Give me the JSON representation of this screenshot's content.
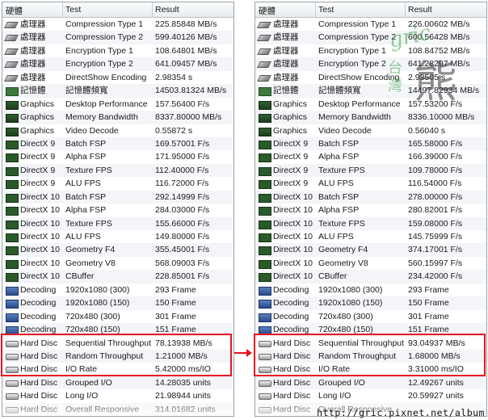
{
  "columns": {
    "device": "硬體",
    "test": "Test",
    "result": "Result"
  },
  "left_rows": [
    {
      "icon": "cpu",
      "device": "處理器",
      "test": "Compression Type 1",
      "result": "225.85848 MB/s"
    },
    {
      "icon": "cpu",
      "device": "處理器",
      "test": "Compression Type 2",
      "result": "599.40126 MB/s"
    },
    {
      "icon": "cpu",
      "device": "處理器",
      "test": "Encryption Type 1",
      "result": "108.64801 MB/s"
    },
    {
      "icon": "cpu",
      "device": "處理器",
      "test": "Encryption Type 2",
      "result": "641.09457 MB/s"
    },
    {
      "icon": "cpu",
      "device": "處理器",
      "test": "DirectShow Encoding",
      "result": "2.98354 s"
    },
    {
      "icon": "mem",
      "device": "記憶體",
      "test": "記憶體頻寬",
      "result": "14503.81324 MB/s"
    },
    {
      "icon": "gpu",
      "device": "Graphics",
      "test": "Desktop Performance",
      "result": "157.56400 F/s"
    },
    {
      "icon": "gpu",
      "device": "Graphics",
      "test": "Memory Bandwidth",
      "result": "8337.80000 MB/s"
    },
    {
      "icon": "gpu",
      "device": "Graphics",
      "test": "Video Decode",
      "result": "0.55872 s"
    },
    {
      "icon": "dx",
      "device": "DirectX 9",
      "test": "Batch FSP",
      "result": "169.57001 F/s"
    },
    {
      "icon": "dx",
      "device": "DirectX 9",
      "test": "Alpha FSP",
      "result": "171.95000 F/s"
    },
    {
      "icon": "dx",
      "device": "DirectX 9",
      "test": "Texture FPS",
      "result": "112.40000 F/s"
    },
    {
      "icon": "dx",
      "device": "DirectX 9",
      "test": "ALU FPS",
      "result": "116.72000 F/s"
    },
    {
      "icon": "dx",
      "device": "DirectX 10",
      "test": "Batch FSP",
      "result": "292.14999 F/s"
    },
    {
      "icon": "dx",
      "device": "DirectX 10",
      "test": "Alpha FSP",
      "result": "284.03000 F/s"
    },
    {
      "icon": "dx",
      "device": "DirectX 10",
      "test": "Texture FPS",
      "result": "155.66000 F/s"
    },
    {
      "icon": "dx",
      "device": "DirectX 10",
      "test": "ALU FPS",
      "result": "149.80000 F/s"
    },
    {
      "icon": "dx",
      "device": "DirectX 10",
      "test": "Geometry F4",
      "result": "355.45001 F/s"
    },
    {
      "icon": "dx",
      "device": "DirectX 10",
      "test": "Geometry V8",
      "result": "568.09003 F/s"
    },
    {
      "icon": "dx",
      "device": "DirectX 10",
      "test": "CBuffer",
      "result": "228.85001 F/s"
    },
    {
      "icon": "dec",
      "device": "Decoding",
      "test": "1920x1080 (300)",
      "result": "293 Frame"
    },
    {
      "icon": "dec",
      "device": "Decoding",
      "test": "1920x1080 (150)",
      "result": "150 Frame"
    },
    {
      "icon": "dec",
      "device": "Decoding",
      "test": "720x480 (300)",
      "result": "301 Frame"
    },
    {
      "icon": "dec",
      "device": "Decoding",
      "test": "720x480 (150)",
      "result": "151 Frame"
    },
    {
      "icon": "hd",
      "device": "Hard Disc",
      "test": "Sequential Throughput",
      "result": "78.13938 MB/s"
    },
    {
      "icon": "hd",
      "device": "Hard Disc",
      "test": "Random Throughput",
      "result": "1.21000 MB/s"
    },
    {
      "icon": "hd",
      "device": "Hard Disc",
      "test": "I/O Rate",
      "result": "5.42000 ms/IO"
    },
    {
      "icon": "hd",
      "device": "Hard Disc",
      "test": "Grouped I/O",
      "result": "14.28035 units"
    },
    {
      "icon": "hd",
      "device": "Hard Disc",
      "test": "Long I/O",
      "result": "21.98944 units"
    },
    {
      "icon": "hd",
      "device": "Hard Disc",
      "test": "Overall Responsive",
      "result": "314.01682 units"
    }
  ],
  "right_rows": [
    {
      "icon": "cpu",
      "device": "處理器",
      "test": "Compression Type 1",
      "result": "226.00602 MB/s"
    },
    {
      "icon": "cpu",
      "device": "處理器",
      "test": "Compression Type 2",
      "result": "600.56428 MB/s"
    },
    {
      "icon": "cpu",
      "device": "處理器",
      "test": "Encryption Type 1",
      "result": "108.84752 MB/s"
    },
    {
      "icon": "cpu",
      "device": "處理器",
      "test": "Encryption Type 2",
      "result": "641.28297 MB/s"
    },
    {
      "icon": "cpu",
      "device": "處理器",
      "test": "DirectShow Encoding",
      "result": "2.93505 s"
    },
    {
      "icon": "mem",
      "device": "記憶體",
      "test": "記憶體頻寬",
      "result": "14497.82934 MB/s"
    },
    {
      "icon": "gpu",
      "device": "Graphics",
      "test": "Desktop Performance",
      "result": "157.53200 F/s"
    },
    {
      "icon": "gpu",
      "device": "Graphics",
      "test": "Memory Bandwidth",
      "result": "8336.10000 MB/s"
    },
    {
      "icon": "gpu",
      "device": "Graphics",
      "test": "Video Decode",
      "result": "0.56040 s"
    },
    {
      "icon": "dx",
      "device": "DirectX 9",
      "test": "Batch FSP",
      "result": "165.58000 F/s"
    },
    {
      "icon": "dx",
      "device": "DirectX 9",
      "test": "Alpha FSP",
      "result": "166.39000 F/s"
    },
    {
      "icon": "dx",
      "device": "DirectX 9",
      "test": "Texture FPS",
      "result": "109.78000 F/s"
    },
    {
      "icon": "dx",
      "device": "DirectX 9",
      "test": "ALU FPS",
      "result": "116.54000 F/s"
    },
    {
      "icon": "dx",
      "device": "DirectX 10",
      "test": "Batch FSP",
      "result": "278.00000 F/s"
    },
    {
      "icon": "dx",
      "device": "DirectX 10",
      "test": "Alpha FSP",
      "result": "280.82001 F/s"
    },
    {
      "icon": "dx",
      "device": "DirectX 10",
      "test": "Texture FPS",
      "result": "159.08000 F/s"
    },
    {
      "icon": "dx",
      "device": "DirectX 10",
      "test": "ALU FPS",
      "result": "145.75999 F/s"
    },
    {
      "icon": "dx",
      "device": "DirectX 10",
      "test": "Geometry F4",
      "result": "374.17001 F/s"
    },
    {
      "icon": "dx",
      "device": "DirectX 10",
      "test": "Geometry V8",
      "result": "560.15997 F/s"
    },
    {
      "icon": "dx",
      "device": "DirectX 10",
      "test": "CBuffer",
      "result": "234.42000 F/s"
    },
    {
      "icon": "dec",
      "device": "Decoding",
      "test": "1920x1080 (300)",
      "result": "293 Frame"
    },
    {
      "icon": "dec",
      "device": "Decoding",
      "test": "1920x1080 (150)",
      "result": "150 Frame"
    },
    {
      "icon": "dec",
      "device": "Decoding",
      "test": "720x480 (300)",
      "result": "301 Frame"
    },
    {
      "icon": "dec",
      "device": "Decoding",
      "test": "720x480 (150)",
      "result": "151 Frame"
    },
    {
      "icon": "hd",
      "device": "Hard Disc",
      "test": "Sequential Throughput",
      "result": "93.04937 MB/s"
    },
    {
      "icon": "hd",
      "device": "Hard Disc",
      "test": "Random Throughput",
      "result": "1.68000 MB/s"
    },
    {
      "icon": "hd",
      "device": "Hard Disc",
      "test": "I/O Rate",
      "result": "3.31000 ms/IO"
    },
    {
      "icon": "hd",
      "device": "Hard Disc",
      "test": "Grouped I/O",
      "result": "12.49267 units"
    },
    {
      "icon": "hd",
      "device": "Hard Disc",
      "test": "Long I/O",
      "result": "20.59927 units"
    },
    {
      "icon": "hd",
      "device": "Hard Disc",
      "test": "Overall Responsive",
      "result": ""
    }
  ],
  "colors": {
    "highlight": "#e8141f"
  },
  "watermark": {
    "url": "http://gric.pixnet.net/album",
    "logo_chars": "gric 台灣 熊"
  }
}
